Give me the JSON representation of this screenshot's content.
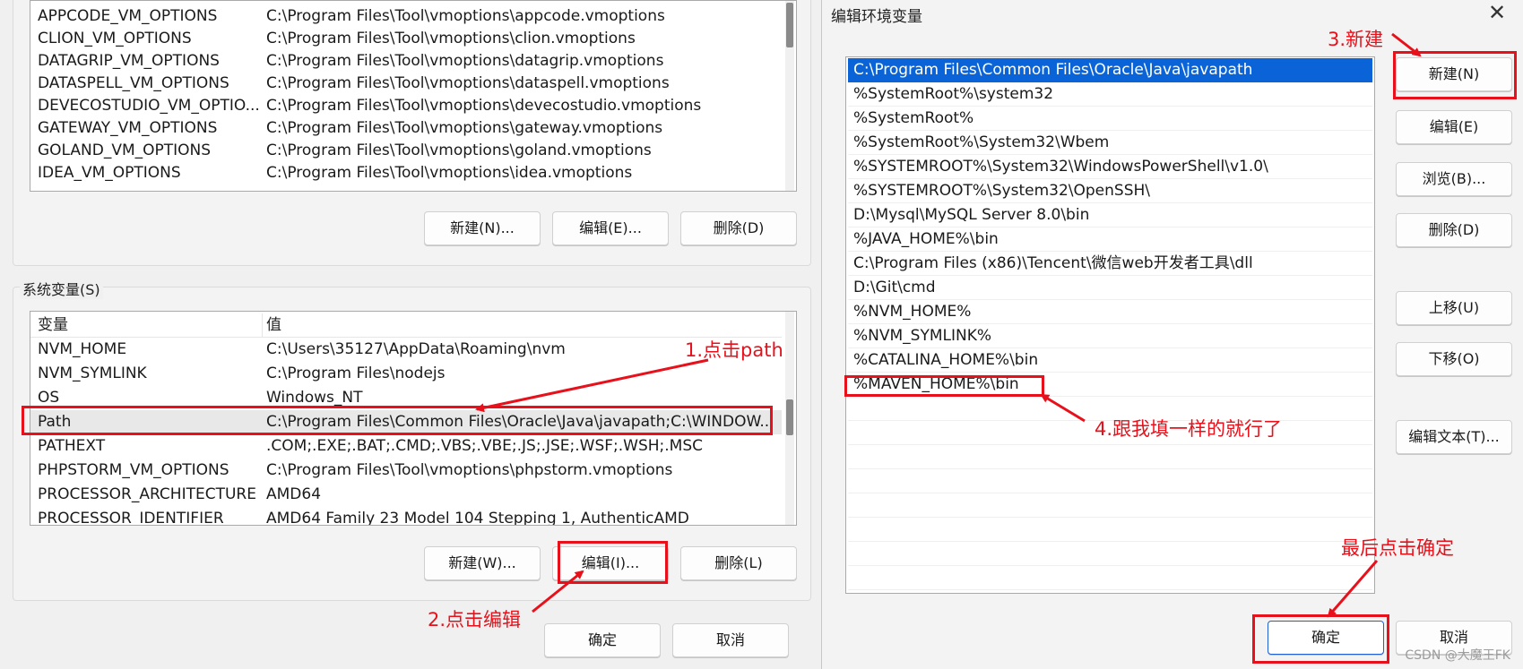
{
  "user_vars": {
    "rows": [
      {
        "name": "APPCODE_VM_OPTIONS",
        "value": "C:\\Program Files\\Tool\\vmoptions\\appcode.vmoptions"
      },
      {
        "name": "CLION_VM_OPTIONS",
        "value": "C:\\Program Files\\Tool\\vmoptions\\clion.vmoptions"
      },
      {
        "name": "DATAGRIP_VM_OPTIONS",
        "value": "C:\\Program Files\\Tool\\vmoptions\\datagrip.vmoptions"
      },
      {
        "name": "DATASPELL_VM_OPTIONS",
        "value": "C:\\Program Files\\Tool\\vmoptions\\dataspell.vmoptions"
      },
      {
        "name": "DEVECOSTUDIO_VM_OPTIO...",
        "value": "C:\\Program Files\\Tool\\vmoptions\\devecostudio.vmoptions"
      },
      {
        "name": "GATEWAY_VM_OPTIONS",
        "value": "C:\\Program Files\\Tool\\vmoptions\\gateway.vmoptions"
      },
      {
        "name": "GOLAND_VM_OPTIONS",
        "value": "C:\\Program Files\\Tool\\vmoptions\\goland.vmoptions"
      },
      {
        "name": "IDEA_VM_OPTIONS",
        "value": "C:\\Program Files\\Tool\\vmoptions\\idea.vmoptions"
      }
    ],
    "buttons": {
      "new": "新建(N)...",
      "edit": "编辑(E)...",
      "delete": "删除(D)"
    }
  },
  "system_vars": {
    "label": "系统变量(S)",
    "col_name": "变量",
    "col_value": "值",
    "rows": [
      {
        "name": "NVM_HOME",
        "value": "C:\\Users\\35127\\AppData\\Roaming\\nvm"
      },
      {
        "name": "NVM_SYMLINK",
        "value": "C:\\Program Files\\nodejs"
      },
      {
        "name": "OS",
        "value": "Windows_NT"
      },
      {
        "name": "Path",
        "value": "C:\\Program Files\\Common Files\\Oracle\\Java\\javapath;C:\\WINDOW..."
      },
      {
        "name": "PATHEXT",
        "value": ".COM;.EXE;.BAT;.CMD;.VBS;.VBE;.JS;.JSE;.WSF;.WSH;.MSC"
      },
      {
        "name": "PHPSTORM_VM_OPTIONS",
        "value": "C:\\Program Files\\Tool\\vmoptions\\phpstorm.vmoptions"
      },
      {
        "name": "PROCESSOR_ARCHITECTURE",
        "value": "AMD64"
      },
      {
        "name": "PROCESSOR_IDENTIFIER",
        "value": "AMD64 Family 23 Model 104 Stepping 1, AuthenticAMD"
      }
    ],
    "selected_row": "Path",
    "buttons": {
      "new": "新建(W)...",
      "edit": "编辑(I)...",
      "delete": "删除(L)"
    }
  },
  "left_footer": {
    "ok": "确定",
    "cancel": "取消"
  },
  "edit_dialog": {
    "title": "编辑环境变量",
    "close_icon": "close-icon",
    "entries": [
      "C:\\Program Files\\Common Files\\Oracle\\Java\\javapath",
      "%SystemRoot%\\system32",
      "%SystemRoot%",
      "%SystemRoot%\\System32\\Wbem",
      "%SYSTEMROOT%\\System32\\WindowsPowerShell\\v1.0\\",
      "%SYSTEMROOT%\\System32\\OpenSSH\\",
      "D:\\Mysql\\MySQL Server 8.0\\bin",
      "%JAVA_HOME%\\bin",
      "C:\\Program Files (x86)\\Tencent\\微信web开发者工具\\dll",
      "D:\\Git\\cmd",
      "%NVM_HOME%",
      "%NVM_SYMLINK%",
      "%CATALINA_HOME%\\bin",
      "%MAVEN_HOME%\\bin"
    ],
    "selected_index": 0,
    "buttons": {
      "new": "新建(N)",
      "edit": "编辑(E)",
      "browse": "浏览(B)...",
      "delete": "删除(D)",
      "move_up": "上移(U)",
      "move_down": "下移(O)",
      "edit_text": "编辑文本(T)...",
      "ok": "确定",
      "cancel": "取消"
    }
  },
  "annotations": {
    "step1": "1.点击path",
    "step2": "2.点击编辑",
    "step3": "3.新建",
    "step4": "4.跟我填一样的就行了",
    "final": "最后点击确定",
    "color": "#e8101a"
  },
  "watermark": "CSDN @大魔王FK"
}
